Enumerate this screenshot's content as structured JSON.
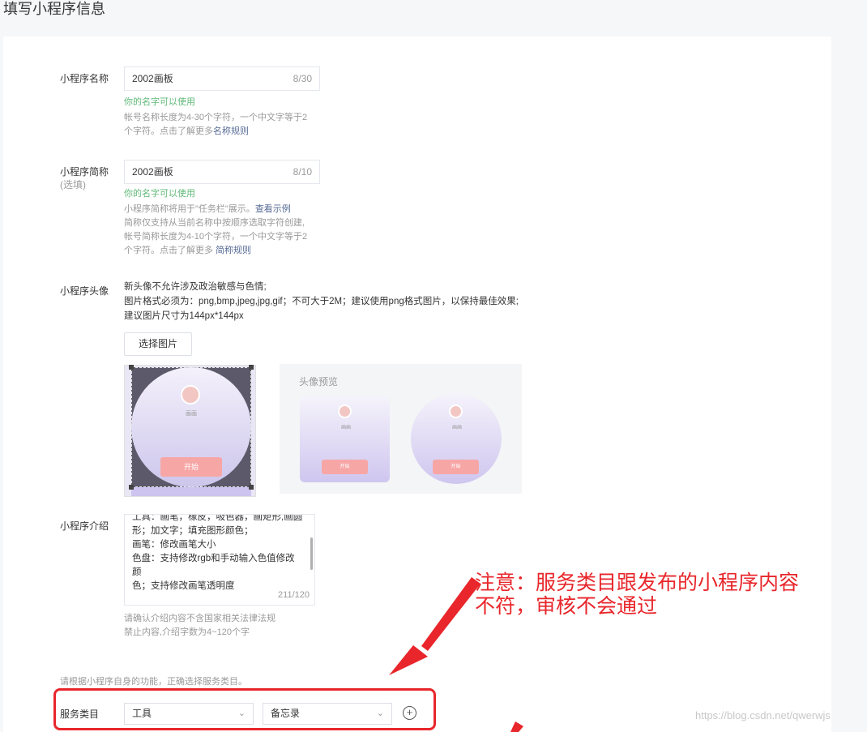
{
  "page_title": "填写小程序信息",
  "name_field": {
    "label": "小程序名称",
    "value": "2002画板",
    "counter": "8/30",
    "ok_tip": "你的名字可以使用",
    "help_line1": "帐号名称长度为4-30个字符，一个中文字等于2",
    "help_line2_prefix": "个字符。点击了解更多",
    "help_link": "名称规则"
  },
  "short_name_field": {
    "label": "小程序简称",
    "optional": "(选填)",
    "value": "2002画板",
    "counter": "8/10",
    "ok_tip": "你的名字可以使用",
    "help_line1_prefix": "小程序简称将用于\"任务栏\"展示。",
    "help_line1_link": "查看示例",
    "help_line2": "简称仅支持从当前名称中按顺序选取字符创建,",
    "help_line3": "帐号简称长度为4-10个字符，一个中文字等于2",
    "help_line4_prefix": "个字符。点击了解更多 ",
    "help_link": "简称规则"
  },
  "avatar": {
    "label": "小程序头像",
    "rule1": "新头像不允许涉及政治敏感与色情;",
    "rule2": "图片格式必须为：png,bmp,jpeg,jpg,gif；不可大于2M；建议使用png格式图片，以保持最佳效果;",
    "rule3": "建议图片尺寸为144px*144px",
    "choose_button": "选择图片",
    "thumb_label": "画画",
    "start_label": "开始",
    "preview_title": "头像预览"
  },
  "intro": {
    "label": "小程序介绍",
    "lines": [
      "工具：画笔，橡皮，吸色器，画矩形,画圆",
      "形；加文字；填充图形颜色；",
      "画笔：修改画笔大小",
      "色盘：支持修改rgb和手动输入色值修改颜",
      "色；支持修改画笔透明度"
    ],
    "counter": "211/120",
    "help_line1": "请确认介绍内容不含国家相关法律法规",
    "help_line2": "禁止内容,介绍字数为4~120个字"
  },
  "service": {
    "hint": "请根据小程序自身的功能，正确选择服务类目。",
    "label": "服务类目",
    "category1": "工具",
    "category2": "备忘录"
  },
  "annotation": {
    "line1": "注意：服务类目跟发布的小程序内容",
    "line2": "不符，审核不会通过",
    "color": "#e8262b"
  },
  "watermark": "https://blog.csdn.net/qwerwjs"
}
